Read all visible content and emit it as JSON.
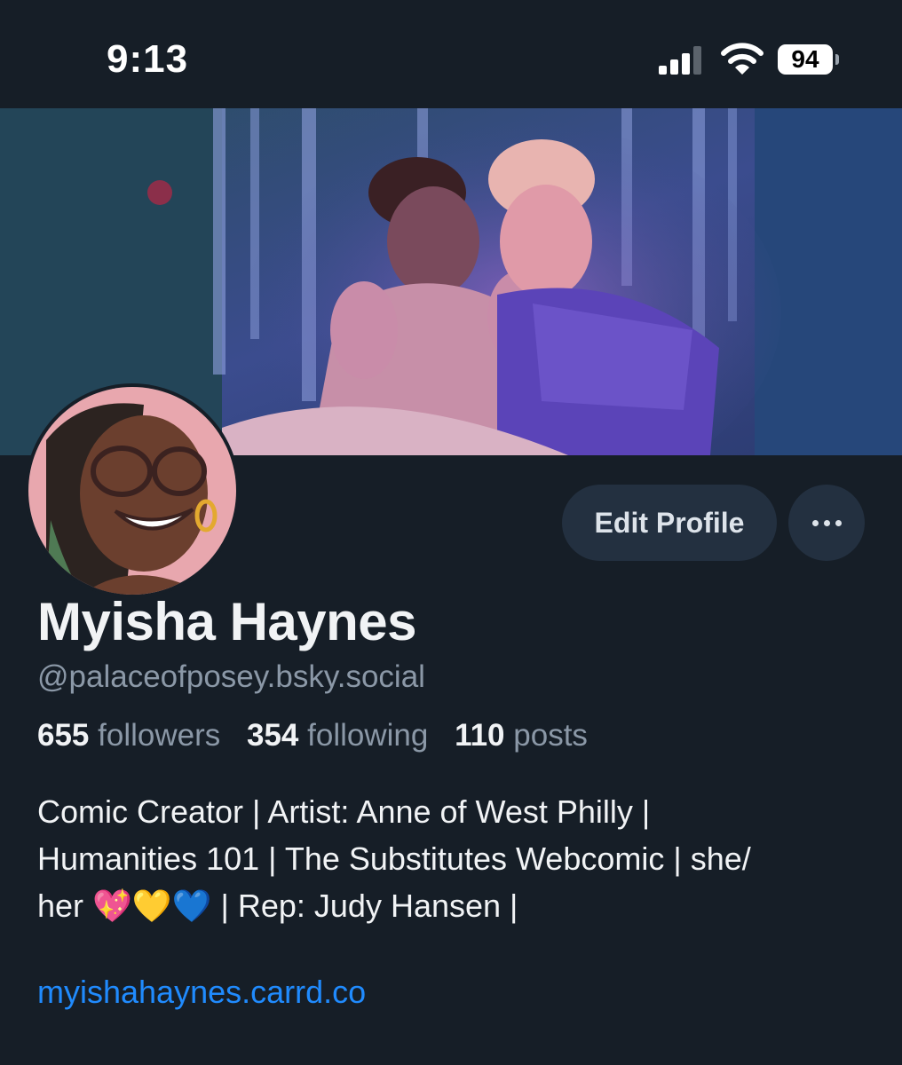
{
  "status_bar": {
    "time": "9:13",
    "battery": "94"
  },
  "profile": {
    "name": "Myisha Haynes",
    "handle": "@palaceofposey.bsky.social",
    "edit_label": "Edit Profile",
    "more_icon": "ellipsis-icon",
    "stats": {
      "followers_count": "655",
      "followers_label": "followers",
      "following_count": "354",
      "following_label": "following",
      "posts_count": "110",
      "posts_label": "posts"
    },
    "bio_lines": [
      "Comic Creator | Artist: Anne of West Philly |",
      "Humanities 101 | The Substitutes Webcomic | she/",
      "her 💖💛💙 | Rep: Judy Hansen |"
    ],
    "link": "myishahaynes.carrd.co"
  },
  "colors": {
    "background": "#161e27",
    "button": "#233040",
    "link": "#208bfe",
    "muted": "#8b98a7"
  }
}
